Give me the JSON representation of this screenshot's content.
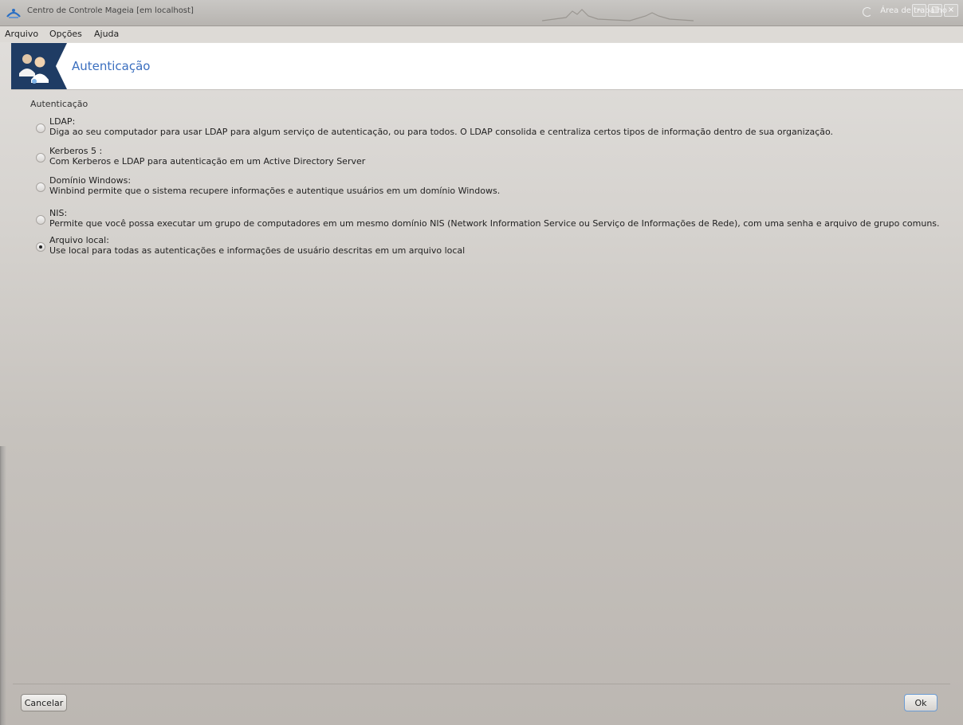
{
  "window": {
    "title": "Centro de Controle Mageia  [em localhost]",
    "right_text": "Área de trabalho",
    "buttons": {
      "minimize": "–",
      "maximize": "□",
      "close": "×"
    }
  },
  "menubar": {
    "items": [
      "Arquivo",
      "Opções",
      "Ajuda"
    ]
  },
  "header": {
    "title": "Autenticação",
    "icon": "users-icon"
  },
  "section": {
    "title": "Autenticação"
  },
  "options": [
    {
      "title": "LDAP:",
      "description": "Diga ao seu computador para usar LDAP para algum serviço de autenticação, ou para todos. O LDAP consolida e centraliza certos tipos de informação dentro de sua organização.",
      "selected": false
    },
    {
      "title": "Kerberos 5 :",
      "description": "Com Kerberos e LDAP para autenticação em um Active Directory Server",
      "selected": false
    },
    {
      "title": "Domínio Windows:",
      "description": "Winbind permite que o sistema recupere informações e autentique usuários em um domínio Windows.",
      "selected": false
    },
    {
      "title": "NIS:",
      "description": "Permite que você possa executar um grupo de computadores em um mesmo domínio NIS (Network Information Service ou Serviço de Informações de Rede), com uma senha e arquivo de grupo comuns.",
      "selected": false
    },
    {
      "title": "Arquivo local:",
      "description": "Use local para todas as autenticações e informações de usuário descritas em um arquivo local",
      "selected": true
    }
  ],
  "footer": {
    "cancel_label": "Cancelar",
    "ok_label": "Ok"
  },
  "colors": {
    "accent": "#3b6fbf",
    "header_bg": "#ffffff"
  }
}
